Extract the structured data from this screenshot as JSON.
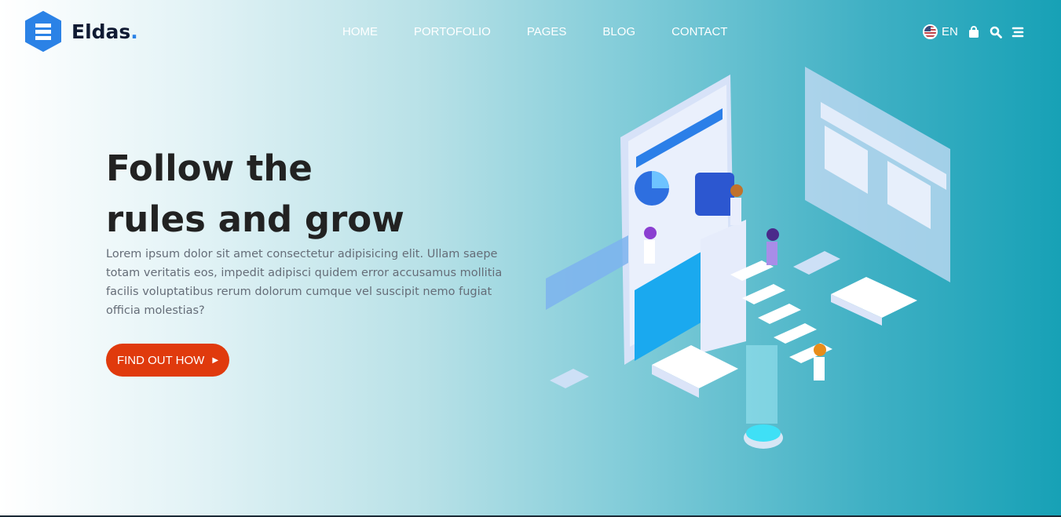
{
  "brand": {
    "name": "Eldas",
    "dot": "."
  },
  "nav": [
    "HOME",
    "PORTOFOLIO",
    "PAGES",
    "BLOG",
    "CONTACT"
  ],
  "header_right": {
    "language": "EN"
  },
  "hero": {
    "title_line1": "Follow the",
    "title_line2": "rules and grow",
    "description": "Lorem ipsum dolor sit amet consectetur adipisicing elit. Ullam saepe totam veritatis eos, impedit adipisci quidem error accusamus mollitia facilis voluptatibus rerum dolorum cumque vel suscipit nemo fugiat officia molestias?",
    "cta": "FIND OUT HOW"
  },
  "colors": {
    "accent": "#e03a0d",
    "brand": "#2b82e6"
  }
}
